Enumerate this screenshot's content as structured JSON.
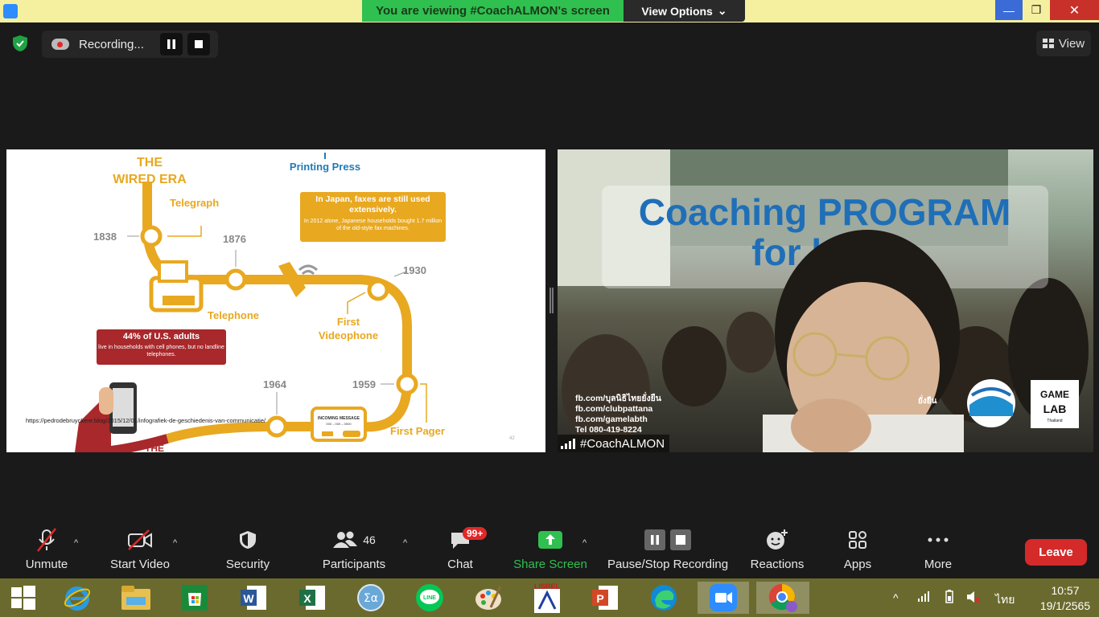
{
  "window": {
    "viewing_banner": "You are viewing #CoachALMON's screen",
    "view_options_label": "View Options",
    "minimize": "—",
    "maximize": "❐",
    "close": "✕"
  },
  "meeting": {
    "recording_label": "Recording...",
    "view_label": "View"
  },
  "shared_slide": {
    "title_line1": "THE",
    "title_line2": "WIRED ERA",
    "printing_press": "Printing Press",
    "telegraph": "Telegraph",
    "year_1838": "1838",
    "year_1876": "1876",
    "telephone": "Telephone",
    "year_1930": "1930",
    "first_videophone_1": "First",
    "first_videophone_2": "Videophone",
    "japan_fax_title": "In Japan, faxes are still used extensively.",
    "japan_fax_body": "In 2012 alone, Japanese households bought 1.7 million of the old-style fax machines.",
    "us_adults_title": "44% of U.S. adults",
    "us_adults_body": "live in households with cell phones, but no landline telephones.",
    "year_1964": "1964",
    "year_1959": "1959",
    "first_pager": "First Pager",
    "incoming_message": "INCOMING MESSAGE",
    "pager_number": "000 – 000 – 0000",
    "source_url": "https://pedrodebruyckere.blog/2015/12/01/infografiek-de-geschiedenis-van-communicatie/",
    "the_partial": "THE",
    "page_number": "42"
  },
  "video": {
    "banner_line1": "Coaching PROGRAM",
    "banner_line2": "for l      r",
    "links": [
      "fb.com/บุลนิธิไทยยั่งยืน",
      "fb.com/clubpattana",
      "fb.com/gamelabth",
      "Tel 080-419-8224"
    ],
    "logo_text_1": "GAME",
    "logo_text_2": "LAB",
    "logo_text_3": "Thailand",
    "thai_partial": "ยั่งยืน",
    "participant_name": "#CoachALMON"
  },
  "toolbar": {
    "unmute": "Unmute",
    "start_video": "Start Video",
    "security": "Security",
    "participants": "Participants",
    "participants_count": "46",
    "chat": "Chat",
    "chat_badge": "99+",
    "share_screen": "Share Screen",
    "pause_stop_recording": "Pause/Stop Recording",
    "reactions": "Reactions",
    "apps": "Apps",
    "more": "More",
    "leave": "Leave"
  },
  "taskbar": {
    "language": "ไทย",
    "time": "10:57",
    "date": "19/1/2565",
    "lisrel_label": "LISREL"
  },
  "colors": {
    "accent_green": "#30c050",
    "leave_red": "#d42a2a",
    "slide_gold": "#e8a820",
    "slide_blue": "#1f7bb8"
  }
}
